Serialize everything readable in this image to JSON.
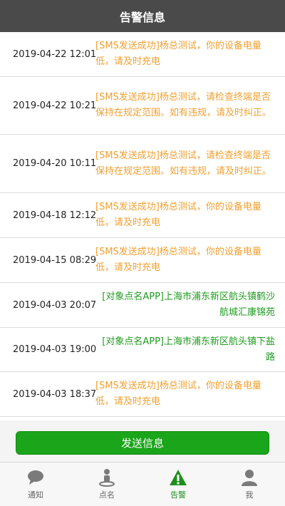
{
  "header": {
    "title": "告警信息"
  },
  "alerts": [
    {
      "time": "2019-04-22 12:01",
      "message": "[SMS发送成功]杨总测试，你的设备电量低，请及时充电",
      "color": "#f0a030"
    },
    {
      "time": "2019-04-22 10:21",
      "message": "[SMS发送成功]杨总测试，请检查终端是否保持在规定范围。如有违规，请及时纠正。",
      "color": "#f0a030"
    },
    {
      "time": "2019-04-20 10:11",
      "message": "[SMS发送成功]杨总测试，请检查终端是否保持在规定范围。如有违规，请及时纠正。",
      "color": "#f0a030"
    },
    {
      "time": "2019-04-18 12:12",
      "message": "[SMS发送成功]杨总测试，你的设备电量低，请及时充电",
      "color": "#f0a030"
    },
    {
      "time": "2019-04-15 08:29",
      "message": "[SMS发送成功]杨总测试，你的设备电量低，请及时充电",
      "color": "#f0a030"
    },
    {
      "time": "2019-04-03 20:07",
      "message": "[对象点名APP]上海市浦东新区航头镇鹤沙航城汇康锦苑",
      "color": "#1e9a1e"
    },
    {
      "time": "2019-04-03 19:00",
      "message": "[对象点名APP]上海市浦东新区航头镇下盐路",
      "color": "#1e9a1e"
    },
    {
      "time": "2019-04-03 18:37",
      "message": "[SMS发送成功]杨总测试，你的设备电量低，请及时充电",
      "color": "#f0a030"
    }
  ],
  "send_button": {
    "label": "发送信息",
    "color": "#1aa51a"
  },
  "tabs": [
    {
      "label": "通知",
      "icon": "chat-bubble-icon"
    },
    {
      "label": "点名",
      "icon": "person-pin-icon"
    },
    {
      "label": "告警",
      "icon": "warning-icon",
      "active": true
    },
    {
      "label": "我",
      "icon": "user-icon"
    }
  ]
}
